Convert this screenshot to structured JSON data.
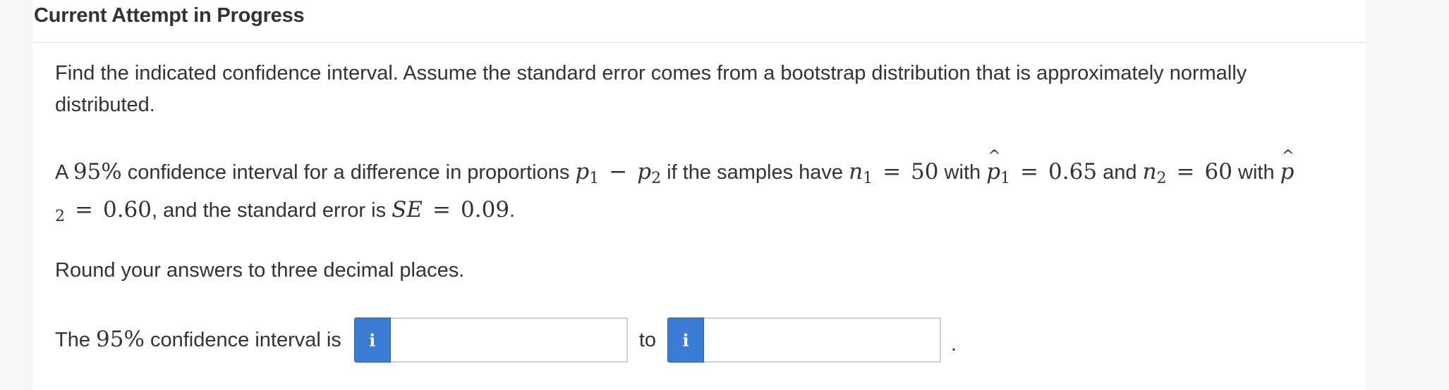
{
  "header": {
    "title": "Current Attempt in Progress"
  },
  "question": {
    "instructions": "Find the indicated confidence interval. Assume the standard error comes from a bootstrap distribution that is approximately normally distributed.",
    "problem": {
      "text_a": "A ",
      "conf_level": "95%",
      "text_b": " confidence interval for a difference in proportions ",
      "p": "p",
      "sub1": "1",
      "sub2": "2",
      "minus": "−",
      "text_c": " if the samples have ",
      "n": "n",
      "eq": "=",
      "n1_value": "50",
      "text_with": " with ",
      "p1hat_value": "0.65",
      "text_and": " and ",
      "n2_value": "60",
      "p2hat_value": "0.60",
      "text_d": ", and the standard error is ",
      "se_label": "SE",
      "se_value": "0.09",
      "text_e": "."
    },
    "rounding": "Round your answers to three decimal places.",
    "answer_line": {
      "prefix_a": "The ",
      "conf_level": "95%",
      "prefix_b": " confidence interval is",
      "info_icon_glyph": "i",
      "to_label": "to",
      "suffix": ".",
      "lower_value": "",
      "upper_value": ""
    }
  },
  "colors": {
    "info_button": "#3a7bd5",
    "background": "#f6f6f6",
    "panel": "#ffffff",
    "text": "#333333"
  }
}
